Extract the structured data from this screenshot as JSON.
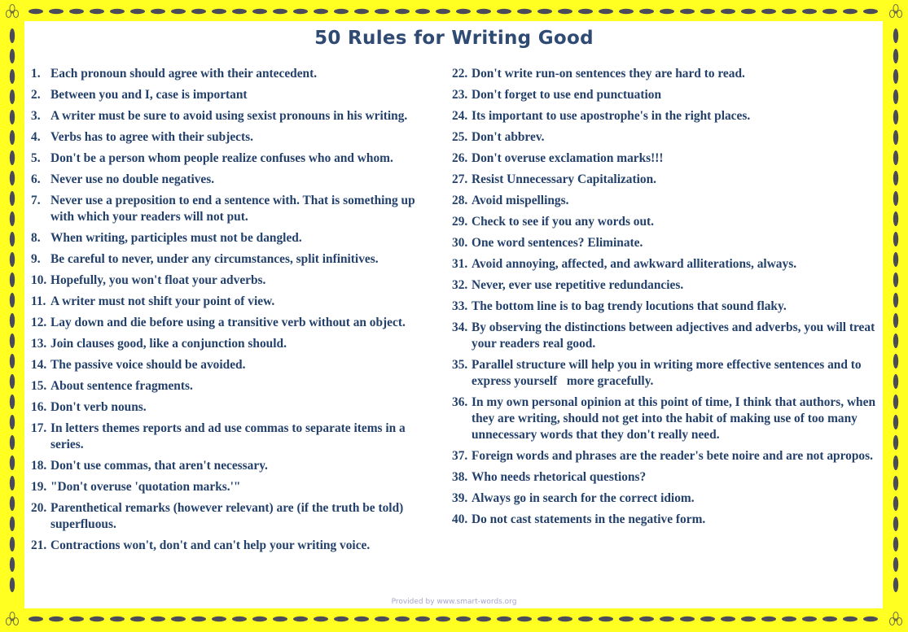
{
  "title": "50 Rules for Writing Good",
  "footer": "Provided by www.smart-words.org",
  "colors": {
    "border": "#ffff22",
    "dash": "#4b4b5a",
    "text": "#24416b",
    "title": "#2f4a73"
  },
  "border_icon": "flower-icon",
  "left_rules": [
    {
      "num": "1.",
      "text": "Each pronoun should agree with their antecedent."
    },
    {
      "num": "2.",
      "text": "Between you and I, case is important"
    },
    {
      "num": "3.",
      "text": "A writer must be sure to avoid using sexist pronouns in his writing."
    },
    {
      "num": "4.",
      "text": "Verbs has to agree with their subjects."
    },
    {
      "num": "5.",
      "text": "Don't be a person whom people realize confuses who and whom."
    },
    {
      "num": "6.",
      "text": "Never use no double negatives."
    },
    {
      "num": "7.",
      "text": "Never use a preposition to end a sentence with. That is something up with which your readers will not put."
    },
    {
      "num": "8.",
      "text": "When writing, participles must not be dangled."
    },
    {
      "num": "9.",
      "text": "Be careful to never, under any circumstances, split infinitives."
    },
    {
      "num": "10.",
      "text": "Hopefully, you won't float your adverbs."
    },
    {
      "num": "11.",
      "text": "A writer must not shift your point of view."
    },
    {
      "num": "12.",
      "text": "Lay down and die before using a transitive verb without an object."
    },
    {
      "num": "13.",
      "text": "Join clauses good, like a conjunction should."
    },
    {
      "num": "14.",
      "text": "The passive voice should be avoided."
    },
    {
      "num": "15.",
      "text": "About sentence fragments."
    },
    {
      "num": "16.",
      "text": "Don't verb nouns."
    },
    {
      "num": "17.",
      "text": "In letters themes reports and ad use commas to separate items in a series."
    },
    {
      "num": "18.",
      "text": "Don't use commas, that aren't necessary."
    },
    {
      "num": "19.",
      "text": "\"Don't overuse 'quotation marks.'\""
    },
    {
      "num": "20.",
      "text": "Parenthetical remarks (however relevant) are (if the truth be told) superfluous."
    },
    {
      "num": "21.",
      "text": "Contractions won't, don't and can't help your writing voice."
    }
  ],
  "right_rules": [
    {
      "num": "22.",
      "text": "Don't write run-on sentences they are hard to read."
    },
    {
      "num": "23.",
      "text": "Don't forget to use end punctuation"
    },
    {
      "num": "24.",
      "text": "Its important to use apostrophe's in the right places."
    },
    {
      "num": "25.",
      "text": "Don't abbrev."
    },
    {
      "num": "26.",
      "text": "Don't overuse exclamation marks!!!"
    },
    {
      "num": "27.",
      "text": "Resist Unnecessary Capitalization."
    },
    {
      "num": "28.",
      "text": "Avoid mispellings."
    },
    {
      "num": "29.",
      "text": "Check to see if you any words out."
    },
    {
      "num": "30.",
      "text": "One word sentences? Eliminate."
    },
    {
      "num": "31.",
      "text": "Avoid annoying, affected, and awkward alliterations, always."
    },
    {
      "num": "32.",
      "text": "Never, ever use repetitive redundancies."
    },
    {
      "num": "33.",
      "text": "The bottom line is to bag trendy locutions that sound flaky."
    },
    {
      "num": "34.",
      "text": "By observing the distinctions between adjectives and adverbs, you will treat your readers real good."
    },
    {
      "num": "35.",
      "text": "Parallel structure will help you in writing more effective sentences and to express yourself   more gracefully."
    },
    {
      "num": "36.",
      "text": "In my own personal opinion at this point of time, I think that authors, when they are writing, should not get into the habit of making use of too many unnecessary words that they don't really need."
    },
    {
      "num": "37.",
      "text": "Foreign words and phrases are the reader's bete noire and are not apropos."
    },
    {
      "num": "38.",
      "text": "Who needs rhetorical questions?"
    },
    {
      "num": "39.",
      "text": "Always go in search for the correct idiom."
    },
    {
      "num": "40.",
      "text": "Do not cast statements in the negative form."
    }
  ]
}
